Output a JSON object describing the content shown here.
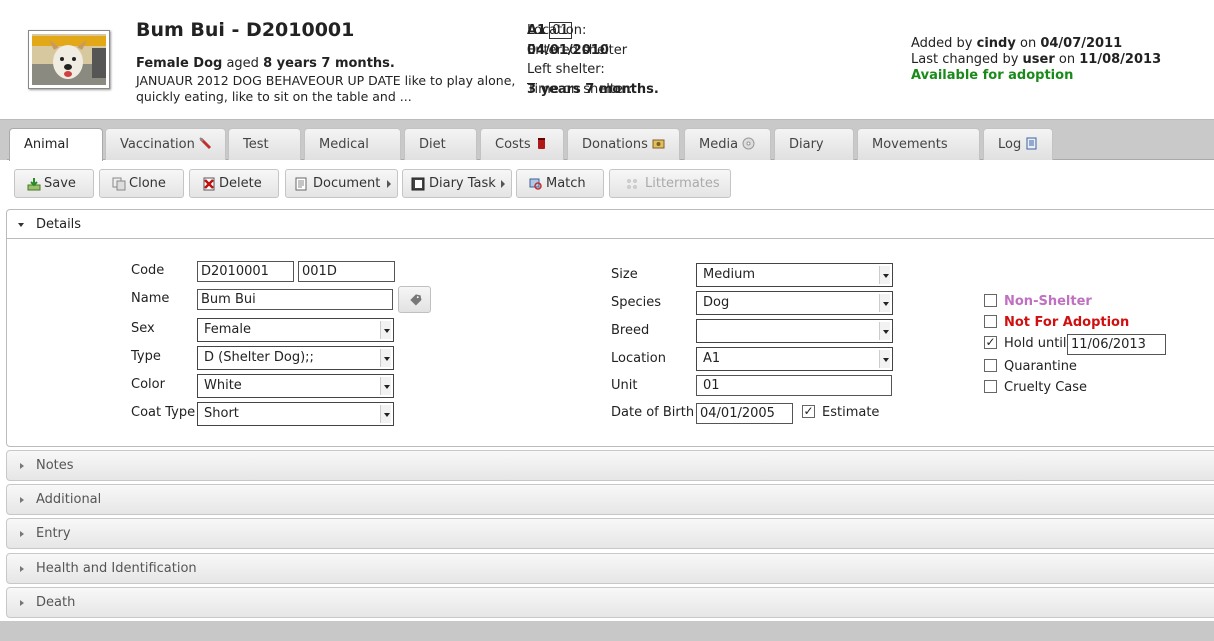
{
  "header": {
    "title": "Bum Bui - D2010001",
    "sex_species": "Female Dog",
    "aged_text": "aged",
    "age": "8 years 7 months.",
    "description": "JANUAUR 2012 DOG BEHAVEOUR UP DATE like to play alone, quickly eating, like to sit on the table and ...",
    "location_label": "Location:",
    "location_value": "A1",
    "location_unit": "01",
    "entered_label": "Entered shelter",
    "entered_value": "04/01/2010",
    "left_label": "Left shelter:",
    "left_value": "",
    "time_label": "Time on shelter:",
    "time_value": "3 years 7 months.",
    "added_by_prefix": "Added by",
    "added_by_user": "cindy",
    "added_on_text": "on",
    "added_date": "04/07/2011",
    "changed_prefix": "Last changed by",
    "changed_user": "user",
    "changed_on_text": "on",
    "changed_date": "11/08/2013",
    "status": "Available for adoption"
  },
  "tabs": [
    {
      "label": "Animal",
      "icon": "none"
    },
    {
      "label": "Vaccination",
      "icon": "syringe-icon"
    },
    {
      "label": "Test",
      "icon": "none"
    },
    {
      "label": "Medical",
      "icon": "none"
    },
    {
      "label": "Diet",
      "icon": "none"
    },
    {
      "label": "Costs",
      "icon": "jar-icon"
    },
    {
      "label": "Donations",
      "icon": "money-icon"
    },
    {
      "label": "Media",
      "icon": "disc-icon"
    },
    {
      "label": "Diary",
      "icon": "none"
    },
    {
      "label": "Movements",
      "icon": "none"
    },
    {
      "label": "Log",
      "icon": "log-icon"
    }
  ],
  "toolbar": {
    "save": "Save",
    "clone": "Clone",
    "delete": "Delete",
    "document": "Document",
    "diary_task": "Diary Task",
    "match": "Match",
    "littermates": "Littermates"
  },
  "sections": {
    "details": "Details",
    "notes": "Notes",
    "additional": "Additional",
    "entry": "Entry",
    "health": "Health and Identification",
    "death": "Death"
  },
  "details": {
    "code_label": "Code",
    "code_value": "D2010001",
    "code_short": "001D",
    "name_label": "Name",
    "name_value": "Bum Bui",
    "sex_label": "Sex",
    "sex_value": "Female",
    "type_label": "Type",
    "type_value": "D (Shelter Dog);;",
    "color_label": "Color",
    "color_value": "White",
    "coat_label": "Coat Type",
    "coat_value": "Short",
    "size_label": "Size",
    "size_value": "Medium",
    "species_label": "Species",
    "species_value": "Dog",
    "breed_label": "Breed",
    "breed_value": "",
    "location_label": "Location",
    "location_value": "A1",
    "unit_label": "Unit",
    "unit_value": "01",
    "dob_label": "Date of Birth",
    "dob_value": "04/01/2005",
    "estimate_label": "Estimate",
    "estimate_checked": true,
    "non_shelter_label": "Non-Shelter",
    "not_for_adoption_label": "Not For Adoption",
    "hold_label": "Hold until",
    "hold_value": "11/06/2013",
    "quarantine_label": "Quarantine",
    "cruelty_label": "Cruelty Case"
  },
  "colors": {
    "status_green": "#1a8a1a",
    "non_shelter": "#c070c0",
    "not_adoption": "#d01010"
  }
}
